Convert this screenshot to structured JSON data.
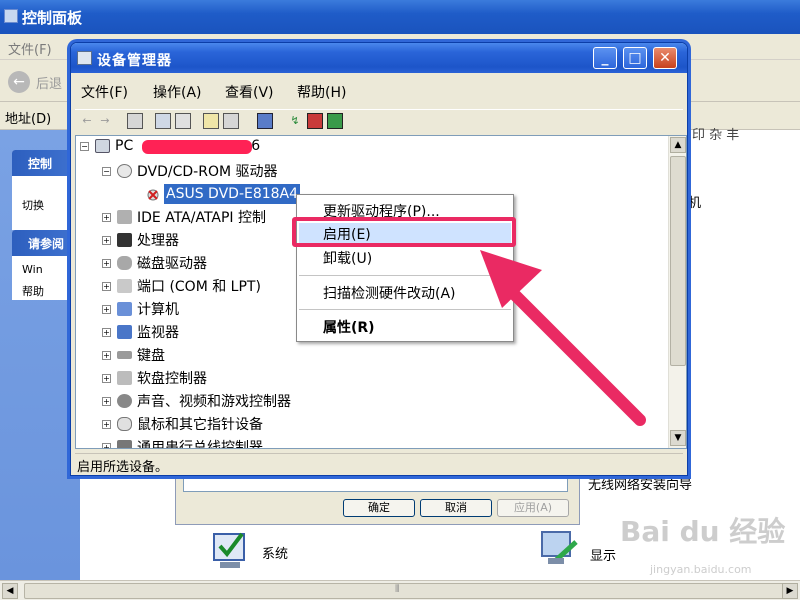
{
  "control_panel": {
    "title": "控制面板",
    "menu_file": "文件(F)",
    "back_label": "后退",
    "address_label": "地址(D)",
    "sidebar_header1": "控制",
    "sidebar_item1": "切换",
    "sidebar_header2": "请参阅",
    "sidebar_item2": "Win",
    "sidebar_item3": "帮助",
    "right_text_top": "印 杂 丰",
    "right_text_mid": "机",
    "right_text_wizard": "无线网络安装向导",
    "icon_system_label": "系统",
    "icon_display_label": "显示",
    "scroll_mark": "⦀"
  },
  "behind_dialog": {
    "ok": "确定",
    "cancel": "取消",
    "apply": "应用(A)"
  },
  "device_manager": {
    "title": "设备管理器",
    "window_buttons": {
      "minimize": "_",
      "maximize": "□",
      "close": "✕"
    },
    "menu": [
      "文件(F)",
      "操作(A)",
      "查看(V)",
      "帮助(H)"
    ],
    "tree": {
      "root_prefix": "PC",
      "root_suffix": "6",
      "dvd_category": "DVD/CD-ROM 驱动器",
      "selected_device": "ASUS DVD-E818A4",
      "categories": [
        "IDE ATA/ATAPI 控制",
        "处理器",
        "磁盘驱动器",
        "端口 (COM 和 LPT)",
        "计算机",
        "监视器",
        "键盘",
        "软盘控制器",
        "声音、视频和游戏控制器",
        "鼠标和其它指针设备",
        "通用串行总线控制器"
      ]
    },
    "status_text": "启用所选设备。"
  },
  "context_menu": {
    "update_driver": "更新驱动程序(P)...",
    "enable": "启用(E)",
    "uninstall": "卸载(U)",
    "scan": "扫描检测硬件改动(A)",
    "properties": "属性(R)"
  },
  "watermark": {
    "main": "Bai du 经验",
    "sub": "jingyan.baidu.com"
  },
  "colors": {
    "highlight": "#ea2a63",
    "selection": "#316ac5",
    "titlebar": "#2a65d9"
  }
}
